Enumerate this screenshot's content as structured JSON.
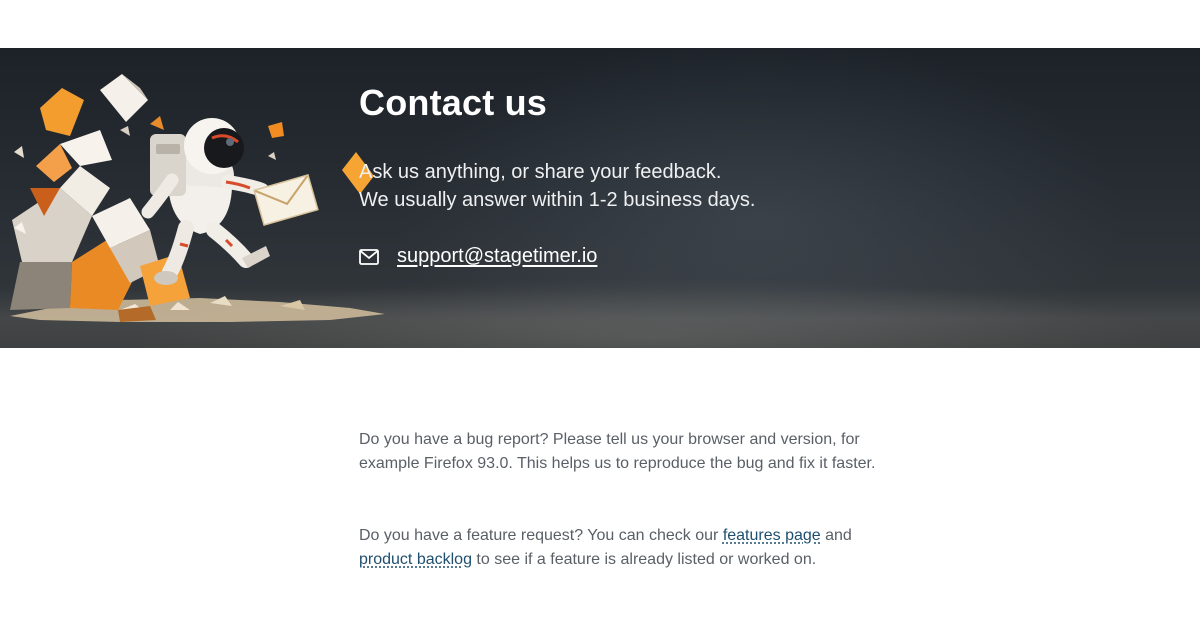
{
  "hero": {
    "title": "Contact us",
    "line1": "Ask us anything, or share your feedback.",
    "line2": "We usually answer within 1-2 business days.",
    "email": "support@stagetimer.io",
    "email_icon": "envelope-icon",
    "illustration": "astronaut-with-envelope-illustration"
  },
  "body": {
    "bug_report": "Do you have a bug report? Please tell us your browser and version, for example Firefox 93.0. This helps us to reproduce the bug and fix it faster.",
    "feature_intro": "Do you have a feature request? You can check our",
    "features_link": "features page",
    "and_text": "and",
    "backlog_link": "product backlog",
    "feature_outro": "to see if a feature is already listed or worked on."
  },
  "colors": {
    "hero_background": "#262c32",
    "link": "#1f4f6e",
    "body_text": "#5a5f66",
    "accent_orange": "#f0962a"
  }
}
